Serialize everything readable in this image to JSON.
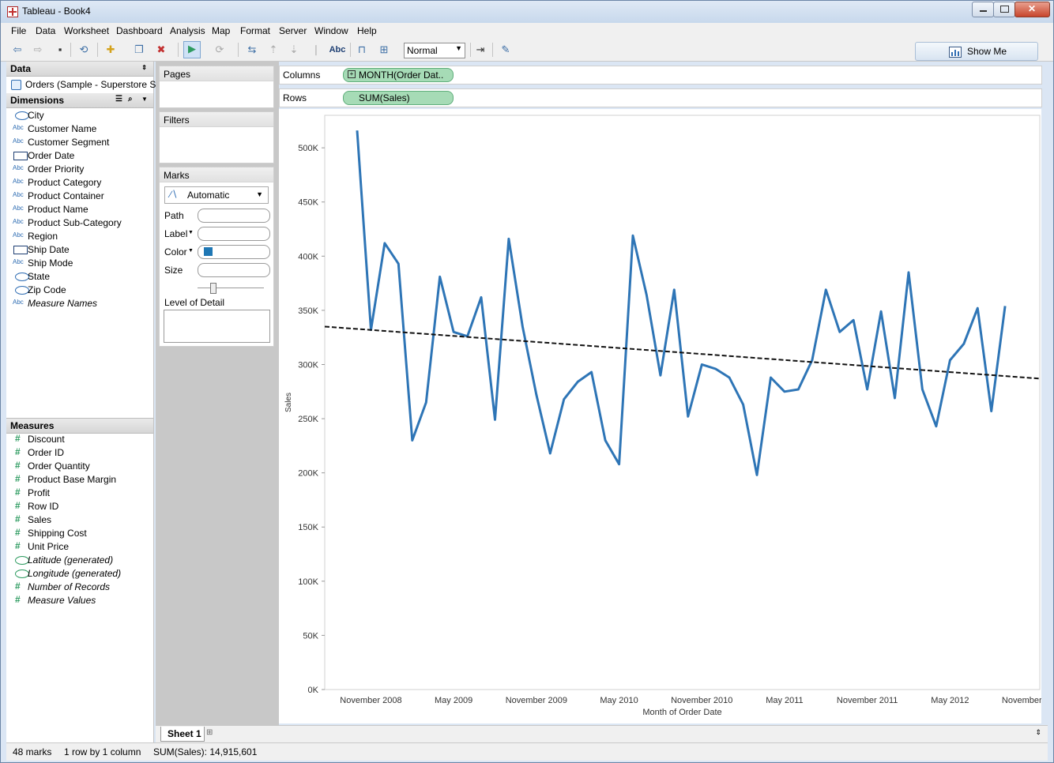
{
  "window": {
    "title": "Tableau - Book4"
  },
  "menu": [
    "File",
    "Data",
    "Worksheet",
    "Dashboard",
    "Analysis",
    "Map",
    "Format",
    "Server",
    "Window",
    "Help"
  ],
  "toolbar": {
    "fit_value": "Normal",
    "abc_label": "Abc",
    "show_me_label": "Show Me"
  },
  "data_pane": {
    "title": "Data",
    "datasource": "Orders (Sample - Superstore S...",
    "dimensions_title": "Dimensions",
    "measures_title": "Measures",
    "dimensions": [
      {
        "label": "City",
        "icon": "globe-icon"
      },
      {
        "label": "Customer Name",
        "icon": "abc-icon"
      },
      {
        "label": "Customer Segment",
        "icon": "abc-icon"
      },
      {
        "label": "Order Date",
        "icon": "calendar-icon"
      },
      {
        "label": "Order Priority",
        "icon": "abc-icon"
      },
      {
        "label": "Product Category",
        "icon": "abc-icon"
      },
      {
        "label": "Product Container",
        "icon": "abc-icon"
      },
      {
        "label": "Product Name",
        "icon": "abc-icon"
      },
      {
        "label": "Product Sub-Category",
        "icon": "abc-icon"
      },
      {
        "label": "Region",
        "icon": "abc-icon"
      },
      {
        "label": "Ship Date",
        "icon": "calendar-icon"
      },
      {
        "label": "Ship Mode",
        "icon": "abc-icon"
      },
      {
        "label": "State",
        "icon": "globe-icon"
      },
      {
        "label": "Zip Code",
        "icon": "globe-icon"
      },
      {
        "label": "Measure Names",
        "icon": "abc-icon"
      }
    ],
    "measures": [
      {
        "label": "Discount",
        "icon": "hash-icon"
      },
      {
        "label": "Order ID",
        "icon": "hash-icon"
      },
      {
        "label": "Order Quantity",
        "icon": "hash-icon"
      },
      {
        "label": "Product Base Margin",
        "icon": "hash-icon"
      },
      {
        "label": "Profit",
        "icon": "hash-icon"
      },
      {
        "label": "Row ID",
        "icon": "hash-icon"
      },
      {
        "label": "Sales",
        "icon": "hash-icon"
      },
      {
        "label": "Shipping Cost",
        "icon": "hash-icon"
      },
      {
        "label": "Unit Price",
        "icon": "hash-icon"
      },
      {
        "label": "Latitude (generated)",
        "icon": "globe-icon"
      },
      {
        "label": "Longitude (generated)",
        "icon": "globe-icon"
      },
      {
        "label": "Number of Records",
        "icon": "hash-icon"
      },
      {
        "label": "Measure Values",
        "icon": "hash-icon"
      }
    ]
  },
  "cards": {
    "pages": "Pages",
    "filters": "Filters",
    "marks": "Marks",
    "mark_type": "Automatic",
    "path": "Path",
    "label": "Label",
    "color": "Color",
    "size": "Size",
    "level_of_detail": "Level of Detail",
    "color_swatch": "#1f77b4"
  },
  "shelves": {
    "columns_label": "Columns",
    "columns_pill": "MONTH(Order Dat..",
    "rows_label": "Rows",
    "rows_pill": "SUM(Sales)"
  },
  "chart_data": {
    "type": "line",
    "x": [
      "2008-10",
      "2008-11",
      "2008-12",
      "2009-01",
      "2009-02",
      "2009-03",
      "2009-04",
      "2009-05",
      "2009-06",
      "2009-07",
      "2009-08",
      "2009-09",
      "2009-10",
      "2009-11",
      "2009-12",
      "2010-01",
      "2010-02",
      "2010-03",
      "2010-04",
      "2010-05",
      "2010-06",
      "2010-07",
      "2010-08",
      "2010-09",
      "2010-10",
      "2010-11",
      "2010-12",
      "2011-01",
      "2011-02",
      "2011-03",
      "2011-04",
      "2011-05",
      "2011-06",
      "2011-07",
      "2011-08",
      "2011-09",
      "2011-10",
      "2011-11",
      "2011-12",
      "2012-01",
      "2012-02",
      "2012-03",
      "2012-04",
      "2012-05",
      "2012-06",
      "2012-07",
      "2012-08",
      "2012-09",
      "2012-10",
      "2012-11",
      "2012-12"
    ],
    "series": [
      {
        "values": [
          516000,
          332000,
          412000,
          393000,
          230000,
          265000,
          381000,
          330000,
          326000,
          362000,
          249000,
          416000,
          335000,
          272000,
          218000,
          268000,
          284000,
          293000,
          230000,
          208000,
          419000,
          364000,
          290000,
          369000,
          252000,
          300000,
          296000,
          288000,
          263000,
          198000,
          288000,
          275000,
          277000,
          304000,
          369000,
          330000,
          341000,
          277000,
          349000,
          269000,
          385000,
          277000,
          243000,
          304000,
          319000,
          352000,
          257000,
          354000,
          null,
          null,
          null
        ],
        "color": "#2e75b6"
      }
    ],
    "trend_line": {
      "start": 335000,
      "end": 287000,
      "style": "dashed"
    },
    "ylim": [
      0,
      530000
    ],
    "y_ticks": [
      "0K",
      "50K",
      "100K",
      "150K",
      "200K",
      "250K",
      "300K",
      "350K",
      "400K",
      "450K",
      "500K"
    ],
    "x_tick_labels": [
      "November 2008",
      "May 2009",
      "November 2009",
      "May 2010",
      "November 2010",
      "May 2011",
      "November 2011",
      "May 2012",
      "November 2012"
    ],
    "xlabel": "Month of Order Date",
    "ylabel": "Sales"
  },
  "status": {
    "marks": "48 marks",
    "dims": "1 row by 1 column",
    "sum": "SUM(Sales): 14,915,601"
  },
  "sheet_tab": "Sheet 1"
}
